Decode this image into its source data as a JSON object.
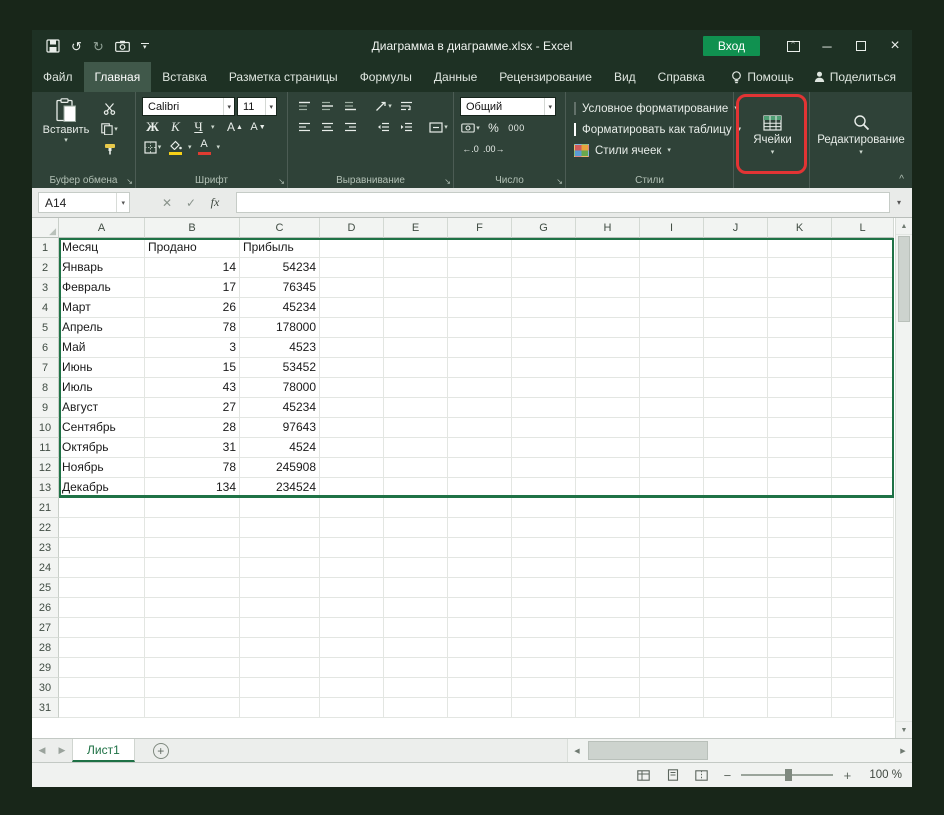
{
  "icons": {
    "undo": "↺",
    "redo": "↻",
    "dropdown": "▾",
    "close": "×",
    "minimize": "─",
    "caret_up": "^",
    "dialog_launcher": "↘",
    "select_all": "◢",
    "up": "▲",
    "down": "▼",
    "left": "◀",
    "right": "▶",
    "cancel": "✕",
    "enter": "✓",
    "fx": "fx",
    "add": "+",
    "zoom_out": "−",
    "zoom_in": "+"
  },
  "titlebar": {
    "title": "Диаграмма в диаграмме.xlsx  -  Excel",
    "signin": "Вход"
  },
  "tabs": {
    "items": [
      {
        "label": "Файл"
      },
      {
        "label": "Главная",
        "active": true
      },
      {
        "label": "Вставка"
      },
      {
        "label": "Разметка страницы"
      },
      {
        "label": "Формулы"
      },
      {
        "label": "Данные"
      },
      {
        "label": "Рецензирование"
      },
      {
        "label": "Вид"
      },
      {
        "label": "Справка"
      }
    ],
    "help": "Помощь",
    "share": "Поделиться"
  },
  "ribbon": {
    "clipboard": {
      "paste": "Вставить",
      "label": "Буфер обмена"
    },
    "font": {
      "name": "Calibri",
      "size": "11",
      "bold": "Ж",
      "italic": "К",
      "underline": "Ч",
      "grow_letter": "А",
      "label": "Шрифт",
      "font_color_letter": "А"
    },
    "alignment": {
      "label": "Выравнивание"
    },
    "number": {
      "format": "Общий",
      "percent": "%",
      "thousands": "000",
      "inc_decimal": "←.0",
      "dec_decimal": ".00→",
      "label": "Число"
    },
    "styles": {
      "items": [
        "Условное форматирование",
        "Форматировать как таблицу",
        "Стили ячеек"
      ],
      "label": "Стили"
    },
    "cells": {
      "label": "Ячейки"
    },
    "editing": {
      "label": "Редактирование"
    }
  },
  "formula_bar": {
    "name_box": "A14"
  },
  "grid": {
    "columns": [
      "A",
      "B",
      "C",
      "D",
      "E",
      "F",
      "G",
      "H",
      "I",
      "J",
      "K",
      "L"
    ],
    "rows": [
      {
        "n": "1",
        "cells": [
          "Месяц",
          "Продано",
          "Прибыль"
        ]
      },
      {
        "n": "2",
        "cells": [
          "Январь",
          "14",
          "54234"
        ]
      },
      {
        "n": "3",
        "cells": [
          "Февраль",
          "17",
          "76345"
        ]
      },
      {
        "n": "4",
        "cells": [
          "Март",
          "26",
          "45234"
        ]
      },
      {
        "n": "5",
        "cells": [
          "Апрель",
          "78",
          "178000"
        ]
      },
      {
        "n": "6",
        "cells": [
          "Май",
          "3",
          "4523"
        ]
      },
      {
        "n": "7",
        "cells": [
          "Июнь",
          "15",
          "53452"
        ]
      },
      {
        "n": "8",
        "cells": [
          "Июль",
          "43",
          "78000"
        ]
      },
      {
        "n": "9",
        "cells": [
          "Август",
          "27",
          "45234"
        ]
      },
      {
        "n": "10",
        "cells": [
          "Сентябрь",
          "28",
          "97643"
        ]
      },
      {
        "n": "11",
        "cells": [
          "Октябрь",
          "31",
          "4524"
        ]
      },
      {
        "n": "12",
        "cells": [
          "Ноябрь",
          "78",
          "245908"
        ]
      },
      {
        "n": "13",
        "cells": [
          "Декабрь",
          "134",
          "234524"
        ]
      },
      {
        "n": "21",
        "cells": []
      },
      {
        "n": "22",
        "cells": []
      },
      {
        "n": "23",
        "cells": []
      },
      {
        "n": "24",
        "cells": []
      },
      {
        "n": "25",
        "cells": []
      },
      {
        "n": "26",
        "cells": []
      },
      {
        "n": "27",
        "cells": []
      },
      {
        "n": "28",
        "cells": []
      },
      {
        "n": "29",
        "cells": []
      },
      {
        "n": "30",
        "cells": []
      },
      {
        "n": "31",
        "cells": []
      }
    ]
  },
  "sheetbar": {
    "tab": "Лист1"
  },
  "statusbar": {
    "zoom": "100 %"
  }
}
